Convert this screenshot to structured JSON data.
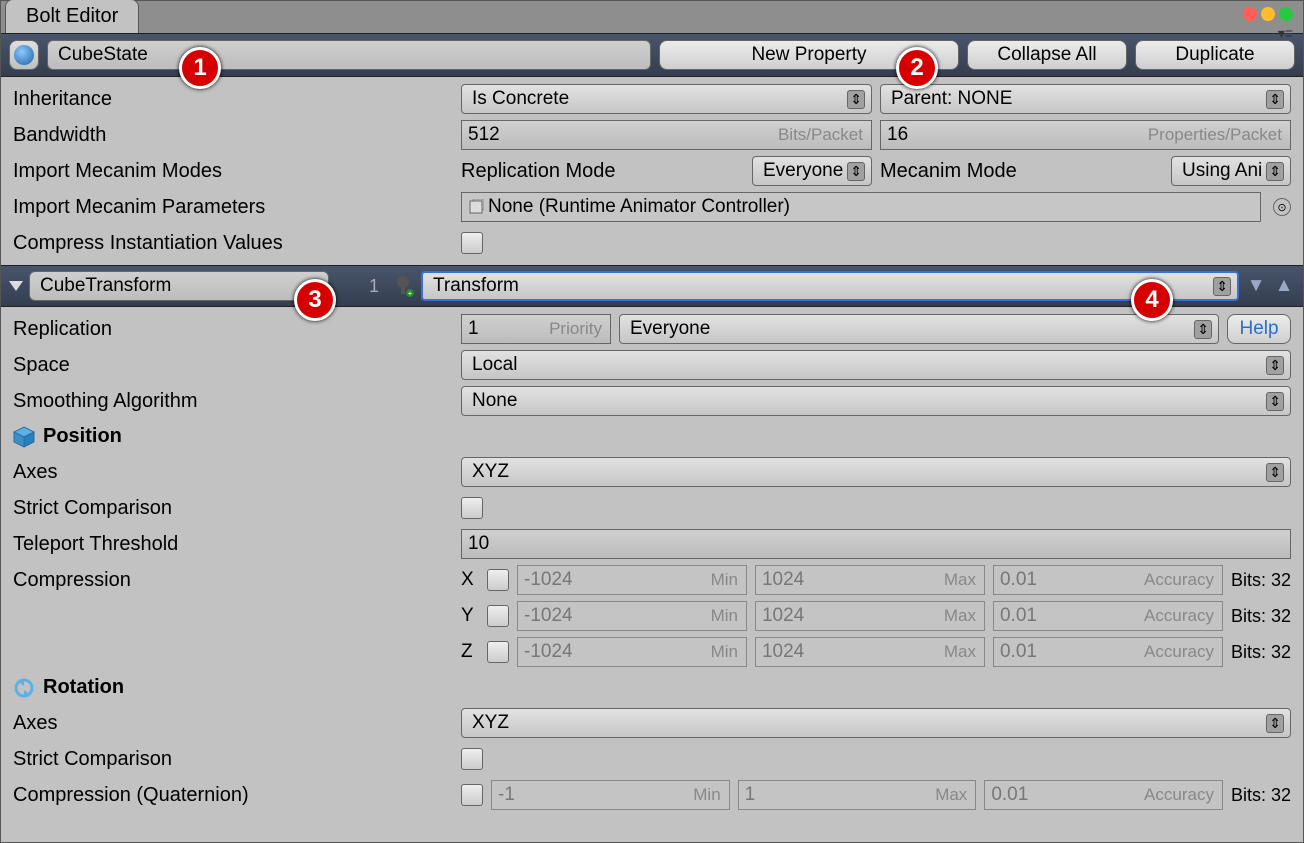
{
  "tab": "Bolt Editor",
  "header": {
    "state_name": "CubeState",
    "new_property": "New Property",
    "collapse_all": "Collapse All",
    "duplicate": "Duplicate"
  },
  "rows": {
    "inheritance": "Inheritance",
    "is_concrete": "Is Concrete",
    "parent": "Parent: NONE",
    "bandwidth": "Bandwidth",
    "bw_bits": "512",
    "bw_bits_hint": "Bits/Packet",
    "bw_props": "16",
    "bw_props_hint": "Properties/Packet",
    "import_modes": "Import Mecanim Modes",
    "replication_mode": "Replication Mode",
    "rep_mode_val": "Everyone",
    "mecanim_mode": "Mecanim Mode",
    "mec_mode_val": "Using Ani",
    "import_params": "Import Mecanim Parameters",
    "animator_none": "None (Runtime Animator Controller)",
    "compress_inst": "Compress Instantiation Values"
  },
  "prop": {
    "name": "CubeTransform",
    "index": "1",
    "type": "Transform"
  },
  "detail": {
    "replication": "Replication",
    "priority_val": "1",
    "priority_hint": "Priority",
    "rep_val": "Everyone",
    "help": "Help",
    "space": "Space",
    "space_val": "Local",
    "smoothing": "Smoothing Algorithm",
    "smoothing_val": "None"
  },
  "position": {
    "title": "Position",
    "axes": "Axes",
    "axes_val": "XYZ",
    "strict": "Strict Comparison",
    "teleport": "Teleport Threshold",
    "teleport_val": "10",
    "compression": "Compression",
    "x": "X",
    "y": "Y",
    "z": "Z",
    "min": "-1024",
    "min_hint": "Min",
    "max": "1024",
    "max_hint": "Max",
    "acc": "0.01",
    "acc_hint": "Accuracy",
    "bits": "Bits: 32"
  },
  "rotation": {
    "title": "Rotation",
    "axes": "Axes",
    "axes_val": "XYZ",
    "strict": "Strict Comparison",
    "compression": "Compression (Quaternion)",
    "min": "-1",
    "min_hint": "Min",
    "max": "1",
    "max_hint": "Max",
    "acc": "0.01",
    "acc_hint": "Accuracy",
    "bits": "Bits: 32"
  },
  "callouts": {
    "c1": "1",
    "c2": "2",
    "c3": "3",
    "c4": "4"
  }
}
